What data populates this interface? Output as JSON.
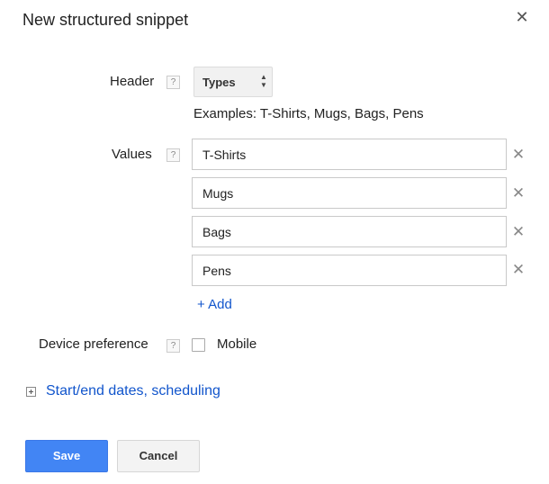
{
  "dialog": {
    "title": "New structured snippet",
    "close_glyph": "✕"
  },
  "header_field": {
    "label": "Header",
    "help_glyph": "?",
    "selected_value": "Types",
    "arrows_up": "▲",
    "arrows_down": "▼",
    "examples": "Examples: T-Shirts, Mugs, Bags, Pens"
  },
  "values_field": {
    "label": "Values",
    "help_glyph": "?",
    "items": [
      {
        "value": "T-Shirts"
      },
      {
        "value": "Mugs"
      },
      {
        "value": "Bags"
      },
      {
        "value": "Pens"
      }
    ],
    "remove_glyph": "✕",
    "add_label": "+ Add"
  },
  "device_field": {
    "label": "Device preference",
    "help_glyph": "?",
    "checkbox_label": "Mobile",
    "checked": false
  },
  "schedule": {
    "link_label": "Start/end dates, scheduling"
  },
  "buttons": {
    "save": "Save",
    "cancel": "Cancel"
  },
  "colors": {
    "primary": "#4285f4",
    "link": "#1155cc"
  }
}
